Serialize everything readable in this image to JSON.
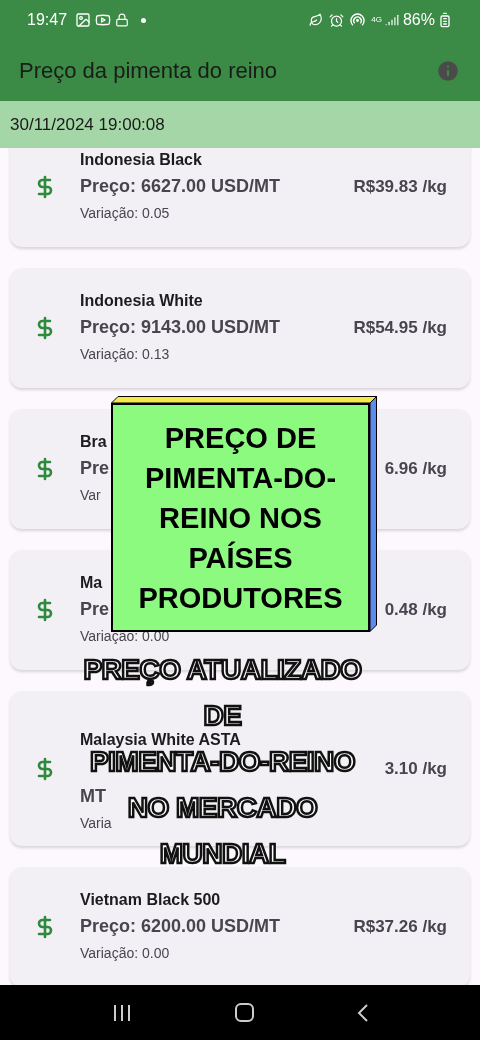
{
  "status_bar": {
    "time": "19:47",
    "network": "4G",
    "battery": "86%"
  },
  "app_bar": {
    "title": "Preço da pimenta do reino"
  },
  "date_bar": {
    "text": "30/11/2024 19:00:08"
  },
  "cards": [
    {
      "kind": "normal",
      "name": "Indonesia Black",
      "price": "Preço: 6627.00 USD/MT",
      "brl": "R$39.83 /kg",
      "variation": "Variação: 0.05"
    },
    {
      "kind": "normal",
      "name": "Indonesia White",
      "price": "Preço: 9143.00 USD/MT",
      "brl": "R$54.95 /kg",
      "variation": "Variação: 0.13"
    },
    {
      "kind": "normal",
      "name": "Bra",
      "price": "Pre",
      "brl": "6.96 /kg",
      "variation": "Var"
    },
    {
      "kind": "normal",
      "name": "Ma",
      "price": "Pre",
      "brl": "0.48 /kg",
      "variation": "Variação: 0.00"
    },
    {
      "kind": "wrapped",
      "name": "Malaysia White ASTA",
      "price": "MT",
      "brl": "3.10 /kg",
      "variation": "Varia"
    },
    {
      "kind": "normal",
      "name": "Vietnam Black 500",
      "price": "Preço: 6200.00 USD/MT",
      "brl": "R$37.26 /kg",
      "variation": "Variação: 0.00"
    }
  ],
  "title_card": {
    "lines": [
      "PREÇO DE",
      "PIMENTA-DO-",
      "REINO NOS",
      "PAÍSES",
      "PRODUTORES"
    ]
  },
  "caption": {
    "lines": [
      "PREÇO ATUALIZADO",
      "DE",
      "PIMENTA-DO-REINO",
      "NO MERCADO",
      "MUNDIAL"
    ]
  }
}
